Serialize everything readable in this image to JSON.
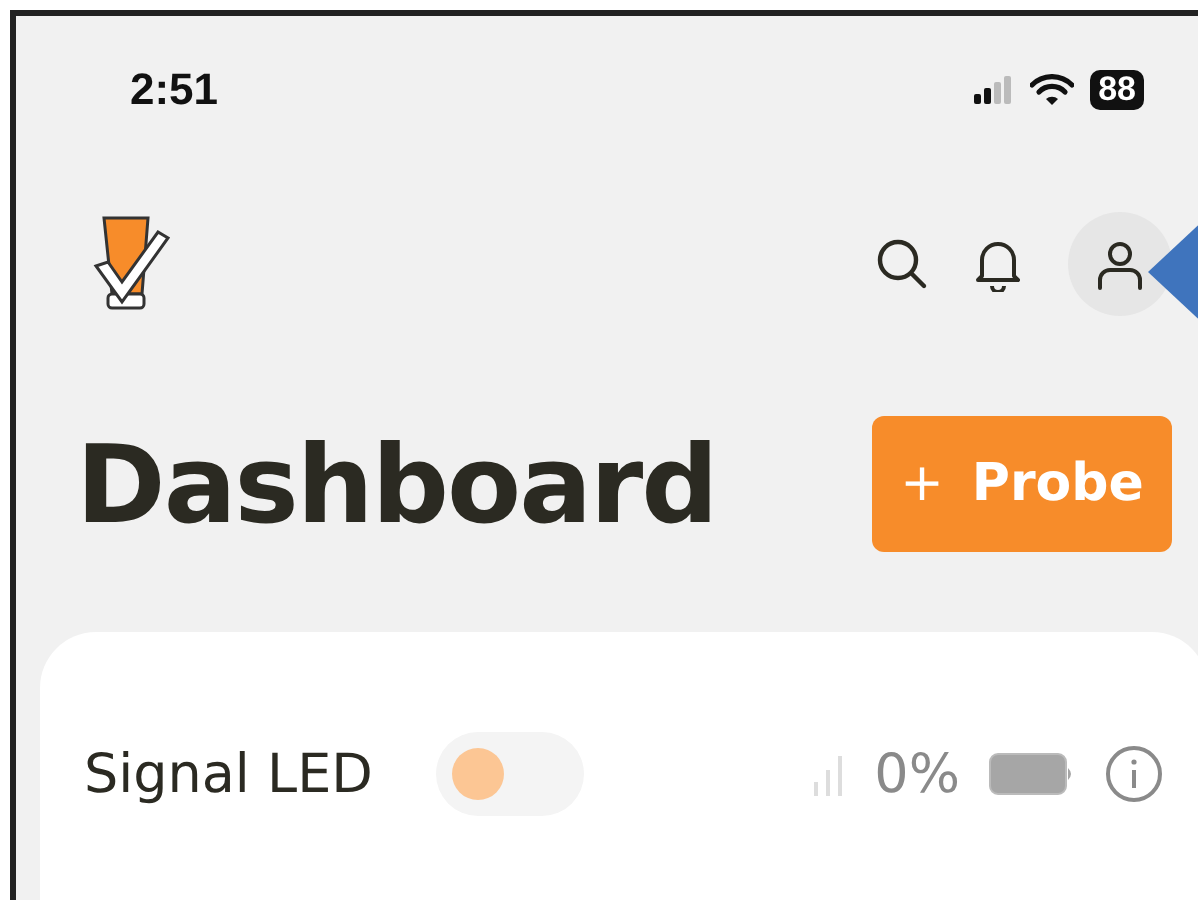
{
  "status_bar": {
    "time": "2:51",
    "battery": "88"
  },
  "title": "Dashboard",
  "new_button": {
    "icon": "+",
    "label": "Probe"
  },
  "devices": [
    {
      "name": "Signal LED",
      "on": false,
      "reading": "0%"
    }
  ]
}
